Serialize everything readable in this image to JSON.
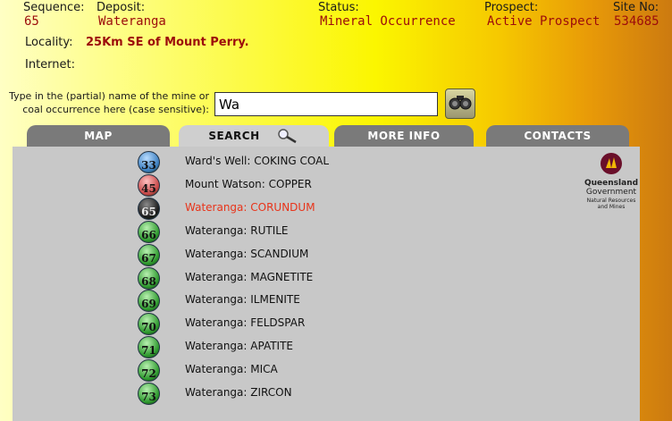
{
  "header": {
    "sequence_label": "Sequence:",
    "sequence_value": "65",
    "deposit_label": "Deposit:",
    "deposit_value": "Wateranga",
    "status_label": "Status:",
    "status_value": "Mineral Occurrence",
    "prospect_label": "Prospect:",
    "prospect_value": "Active Prospect",
    "site_label": "Site No:",
    "site_value": "534685",
    "locality_label": "Locality:",
    "locality_value": "25Km SE of Mount Perry.",
    "internet_label": "Internet:"
  },
  "search": {
    "prompt_line1": "Type in the (partial) name of the mine or",
    "prompt_line2": "coal occurrence here (case sensitive):",
    "value": "Wa",
    "button_icon": "binoculars-icon"
  },
  "tabs": [
    {
      "label": "MAP",
      "active": false
    },
    {
      "label": "SEARCH",
      "active": true,
      "icon": "magnifier-icon"
    },
    {
      "label": "MORE INFO",
      "active": false
    },
    {
      "label": "CONTACTS",
      "active": false
    }
  ],
  "logo": {
    "line1": "Queensland",
    "line2": "Government",
    "line3": "Natural Resources",
    "line4": "and Mines"
  },
  "results": [
    {
      "num": "33",
      "text": "Ward's Well: COKING COAL",
      "color": "blue",
      "selected": false
    },
    {
      "num": "45",
      "text": "Mount Watson: COPPER",
      "color": "red",
      "selected": false
    },
    {
      "num": "65",
      "text": "Wateranga: CORUNDUM",
      "color": "black",
      "selected": true
    },
    {
      "num": "66",
      "text": "Wateranga: RUTILE",
      "color": "green",
      "selected": false
    },
    {
      "num": "67",
      "text": "Wateranga: SCANDIUM",
      "color": "green",
      "selected": false
    },
    {
      "num": "68",
      "text": "Wateranga: MAGNETITE",
      "color": "green",
      "selected": false
    },
    {
      "num": "69",
      "text": "Wateranga: ILMENITE",
      "color": "green",
      "selected": false
    },
    {
      "num": "70",
      "text": "Wateranga: FELDSPAR",
      "color": "green",
      "selected": false
    },
    {
      "num": "71",
      "text": "Wateranga: APATITE",
      "color": "green",
      "selected": false
    },
    {
      "num": "72",
      "text": "Wateranga: MICA",
      "color": "green",
      "selected": false
    },
    {
      "num": "73",
      "text": "Wateranga: ZIRCON",
      "color": "green",
      "selected": false
    }
  ],
  "colors": {
    "value_text": "#9c0c0c",
    "selected_text": "#e8341a",
    "ball_blue": "#3d7fc0",
    "ball_red": "#c84848",
    "ball_black": "#1c1c1c",
    "ball_green": "#2f9a2f"
  }
}
